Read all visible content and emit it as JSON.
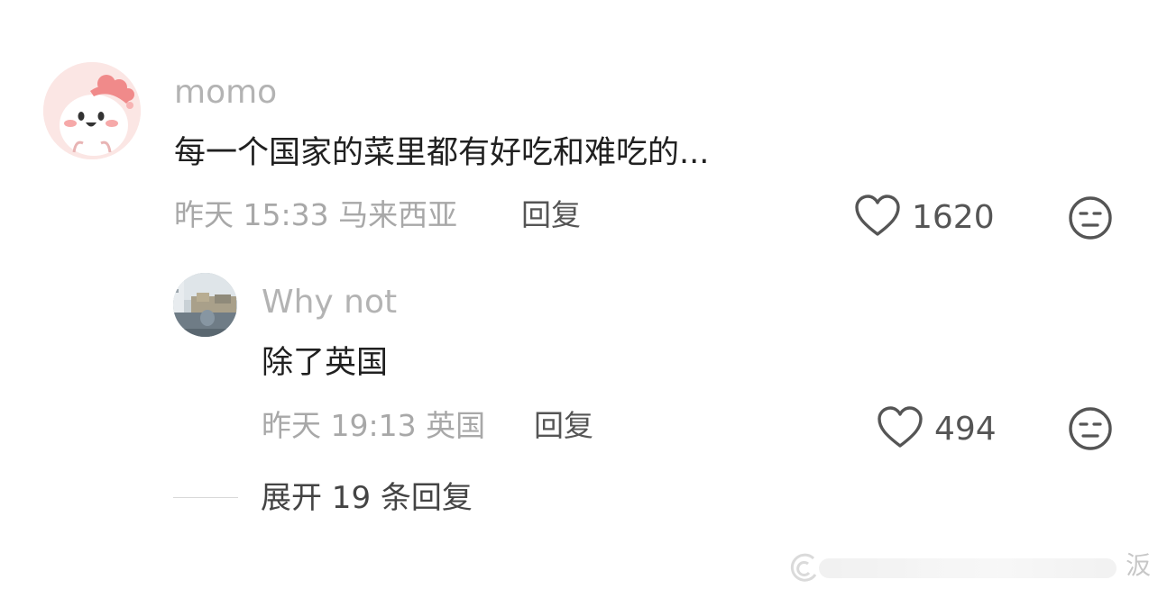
{
  "comment": {
    "avatar_icon": "cartoon-avatar-icon",
    "username": "momo",
    "text": "每一个国家的菜里都有好吃和难吃的...",
    "meta": "昨天 15:33 马来西亚",
    "reply_label": "回复",
    "likes": "1620",
    "like_icon": "heart-outline-icon",
    "dislike_icon": "unhappy-face-icon"
  },
  "reply": {
    "avatar_icon": "city-photo-avatar-icon",
    "username": "Why not",
    "text": "除了英国",
    "meta": "昨天 19:13 英国",
    "reply_label": "回复",
    "likes": "494",
    "like_icon": "heart-outline-icon",
    "dislike_icon": "unhappy-face-icon"
  },
  "expand": {
    "label": "展开 19 条回复"
  },
  "watermark": {
    "char": "汳"
  },
  "colors": {
    "username": "#b3b3b3",
    "meta": "#a8a8a8",
    "text": "#202020",
    "action": "#555555"
  }
}
